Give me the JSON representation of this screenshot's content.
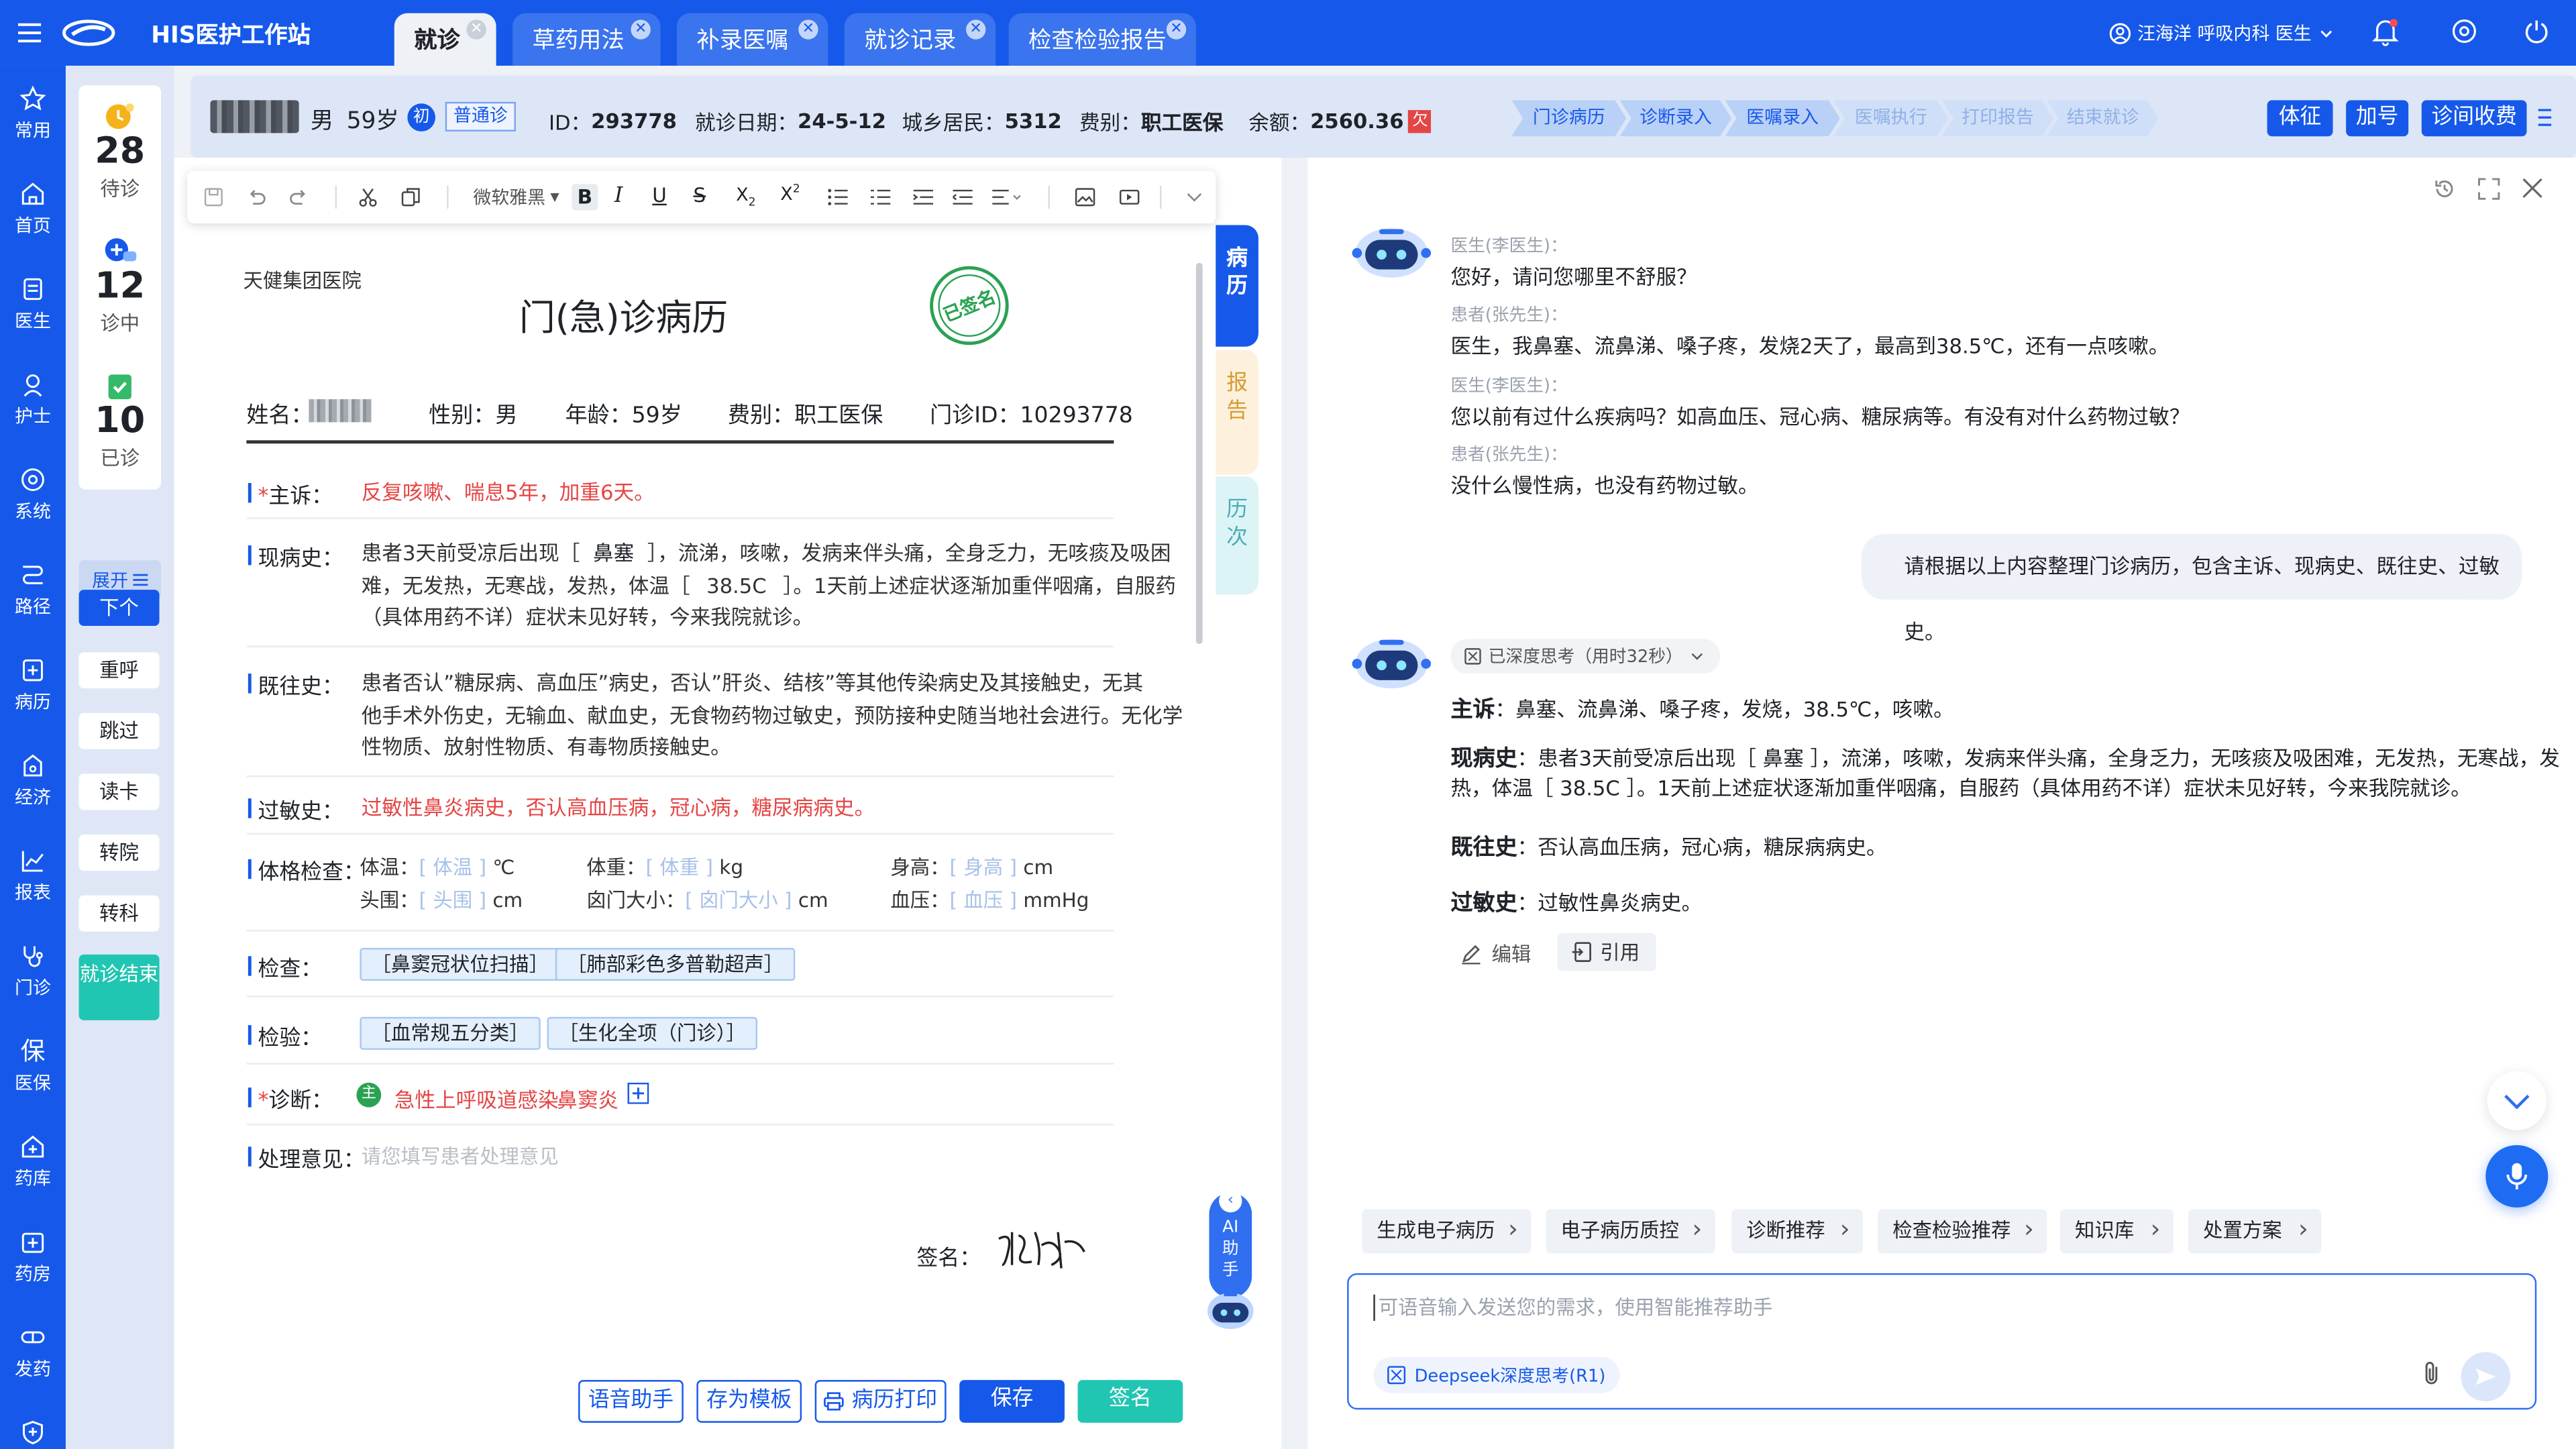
{
  "app": {
    "title": "HIS医护工作站"
  },
  "tabs": [
    {
      "label": "就诊",
      "active": true
    },
    {
      "label": "草药用法"
    },
    {
      "label": "补录医嘱"
    },
    {
      "label": "就诊记录"
    },
    {
      "label": "检查检验报告"
    }
  ],
  "user": {
    "name": "汪海洋",
    "dept": "呼吸内科",
    "role": "医生"
  },
  "nav": [
    {
      "label": "常用"
    },
    {
      "label": "首页"
    },
    {
      "label": "医生"
    },
    {
      "label": "护士"
    },
    {
      "label": "系统"
    },
    {
      "label": "路径"
    },
    {
      "label": "病历"
    },
    {
      "label": "经济"
    },
    {
      "label": "报表"
    },
    {
      "label": "门诊"
    },
    {
      "label": "医保"
    },
    {
      "label": "药库"
    },
    {
      "label": "药房"
    },
    {
      "label": "发药"
    }
  ],
  "queue": {
    "waiting": {
      "count": "28",
      "label": "待诊"
    },
    "in_progress": {
      "count": "12",
      "label": "诊中"
    },
    "done": {
      "count": "10",
      "label": "已诊"
    },
    "expand": "展开",
    "buttons": [
      "下个",
      "重呼",
      "跳过",
      "读卡",
      "转院",
      "转科",
      "就诊结束"
    ]
  },
  "patient": {
    "sex": "男",
    "age": "59岁",
    "first_badge": "初",
    "visit_type": "普通诊",
    "id_label": "ID：",
    "id": "293778",
    "date_label": "就诊日期：",
    "date": "24-5-12",
    "insurance_label": "城乡居民：",
    "insurance": "5312",
    "fee_label": "费别：",
    "fee": "职工医保",
    "balance_label": "余额：",
    "balance": "2560.36",
    "arrears_badge": "欠"
  },
  "steps": [
    "门诊病历",
    "诊断录入",
    "医嘱录入",
    "医嘱执行",
    "打印报告",
    "结束就诊"
  ],
  "header_buttons": [
    "体征",
    "加号",
    "诊间收费"
  ],
  "toolbar": {
    "font": "微软雅黑"
  },
  "record": {
    "hospital": "天健集团医院",
    "title": "门(急)诊病历",
    "stamp": "已签名",
    "name_label": "姓名：",
    "sex_label": "性别：男",
    "age_label": "年龄：59岁",
    "fee_label": "费别：职工医保",
    "clinic_id_label": "门诊ID：10293778",
    "chief_label": "主诉：",
    "chief": "反复咳嗽、喘息5年，加重6天。",
    "present_label": "现病史：",
    "present_line1_a": "患者3天前受凉后出现［",
    "present_line1_field": "鼻塞",
    "present_line1_b": "］，流涕，咳嗽，发病来伴头痛，全身乏力，无咳痰及吸困",
    "present_line2_a": "难，无发热，无寒战，发热，体温［",
    "present_line2_field": "38.5C",
    "present_line2_b": "］。1天前上述症状逐渐加重伴咽痛，自服药",
    "present_line3": "（具体用药不详）症状未见好转，今来我院就诊。",
    "past_label": "既往史：",
    "past_line1": "患者否认”糖尿病、高血压”病史，否认”肝炎、结核”等其他传染病史及其接触史，无其",
    "past_line2": "他手术外伤史，无输血、献血史，无食物药物过敏史，预防接种史随当地社会进行。无化学",
    "past_line3": "性物质、放射性物质、有毒物质接触史。",
    "allergy_label": "过敏史：",
    "allergy": "过敏性鼻炎病史，否认高血压病，冠心病，糖尿病病史。",
    "exam_label": "体格检查：",
    "vitals": {
      "temp": "体温：",
      "temp_ph": "体温",
      "temp_unit": "℃",
      "weight": "体重：",
      "weight_ph": "体重",
      "weight_unit": "kg",
      "height": "身高：",
      "height_ph": "身高",
      "height_unit": "cm",
      "head": "头围：",
      "head_ph": "头围",
      "head_unit": "cm",
      "fontanel": "囟门大小：",
      "fontanel_ph": "囟门大小",
      "fontanel_unit": "cm",
      "bp": "血压：",
      "bp_ph": "血压",
      "bp_unit": "mmHg"
    },
    "check_label": "检查：",
    "checks": [
      "［鼻窦冠状位扫描］",
      "［肺部彩色多普勒超声］"
    ],
    "lab_label": "检验：",
    "labs": [
      "［血常规五分类］",
      "［生化全项（门诊）］"
    ],
    "diag_label": "诊断：",
    "diag_badge": "主",
    "diagnoses": [
      "急性上呼吸道感染",
      "鼻窦炎"
    ],
    "treat_label": "处理意见：",
    "treat_placeholder": "请您填写患者处理意见",
    "sign_label": "签名："
  },
  "side_tabs": [
    "病历",
    "报告",
    "历次"
  ],
  "ai_float": {
    "label": "AI助手"
  },
  "bottom_buttons": [
    "语音助手",
    "存为模板",
    "病历打印",
    "保存",
    "签名"
  ],
  "chat": {
    "messages": [
      {
        "who": "医生(李医生)：",
        "text": "您好，请问您哪里不舒服？"
      },
      {
        "who": "患者(张先生)：",
        "text": "医生，我鼻塞、流鼻涕、嗓子疼，发烧2天了，最高到38.5℃，还有一点咳嗽。"
      },
      {
        "who": "医生(李医生)：",
        "text": "您以前有过什么疾病吗？如高血压、冠心病、糖尿病等。有没有对什么药物过敏？"
      },
      {
        "who": "患者(张先生)：",
        "text": "没什么慢性病，也没有药物过敏。"
      }
    ],
    "request": "请根据以上内容整理门诊病历，包含主诉、现病史、既往史、过敏史。",
    "thinking": "已深度思考（用时32秒）",
    "answer": {
      "chief_label": "主诉",
      "chief": "：鼻塞、流鼻涕、嗓子疼，发烧，38.5℃，咳嗽。",
      "present_label": "现病史",
      "present1": "：患者3天前受凉后出现［ 鼻塞 ］，流涕，咳嗽，发病来伴头痛，全身乏力，无咳痰及吸困难，无发热，无寒战，发",
      "present2": "热，体温［ 38.5C ］。1天前上述症状逐渐加重伴咽痛，自服药（具体用药不详）症状未见好转，今来我院就诊。",
      "past_label": "既往史",
      "past": "：否认高血压病，冠心病，糖尿病病史。",
      "allergy_label": "过敏史",
      "allergy": "：过敏性鼻炎病史。"
    },
    "edit": "编辑",
    "quote": "引用",
    "suggestions": [
      "生成电子病历",
      "电子病历质控",
      "诊断推荐",
      "检查检验推荐",
      "知识库",
      "处置方案"
    ],
    "input_placeholder": "可语音输入发送您的需求，使用智能推荐助手",
    "model": "Deepseek深度思考(R1)"
  }
}
